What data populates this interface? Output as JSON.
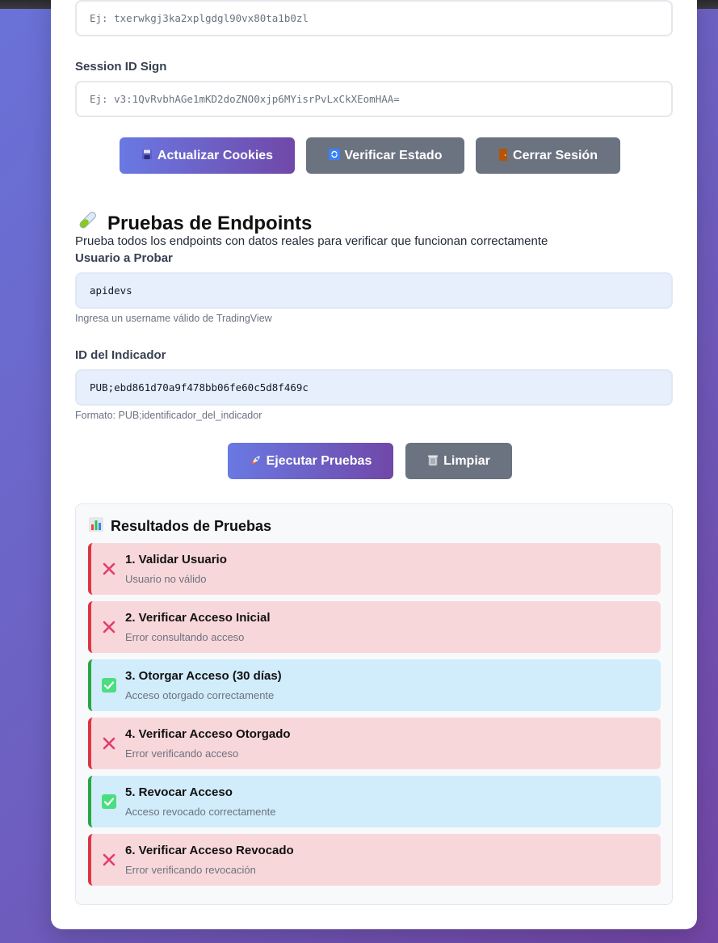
{
  "cookies": {
    "session_id_placeholder": "Ej: txerwkgj3ka2xplgdgl90vx80ta1b0zl",
    "sign_label": "Session ID Sign",
    "sign_placeholder": "Ej: v3:1QvRvbhAGe1mKD2doZNO0xjp6MYisrPvLxCkXEomHAA=",
    "buttons": {
      "update": "Actualizar Cookies",
      "verify": "Verificar Estado",
      "logout": "Cerrar Sesión"
    }
  },
  "tests": {
    "title": "Pruebas de Endpoints",
    "description": "Prueba todos los endpoints con datos reales para verificar que funcionan correctamente",
    "user_label": "Usuario a Probar",
    "user_value": "apidevs",
    "user_hint": "Ingresa un username válido de TradingView",
    "indicator_label": "ID del Indicador",
    "indicator_value": "PUB;ebd861d70a9f478bb06fe60c5d8f469c",
    "indicator_hint": "Formato: PUB;identificador_del_indicador",
    "run_button": "Ejecutar Pruebas",
    "clear_button": "Limpiar"
  },
  "results": {
    "title": "Resultados de Pruebas",
    "items": [
      {
        "title": "1. Validar Usuario",
        "message": "Usuario no válido",
        "status": "fail"
      },
      {
        "title": "2. Verificar Acceso Inicial",
        "message": "Error consultando acceso",
        "status": "fail"
      },
      {
        "title": "3. Otorgar Acceso (30 días)",
        "message": "Acceso otorgado correctamente",
        "status": "ok"
      },
      {
        "title": "4. Verificar Acceso Otorgado",
        "message": "Error verificando acceso",
        "status": "fail"
      },
      {
        "title": "5. Revocar Acceso",
        "message": "Acceso revocado correctamente",
        "status": "ok"
      },
      {
        "title": "6. Verificar Acceso Revocado",
        "message": "Error verificando revocación",
        "status": "fail"
      }
    ]
  },
  "colors": {
    "accent_start": "#6a79e3",
    "accent_end": "#7048a8",
    "fail": "#dc3545",
    "ok": "#28a745"
  }
}
